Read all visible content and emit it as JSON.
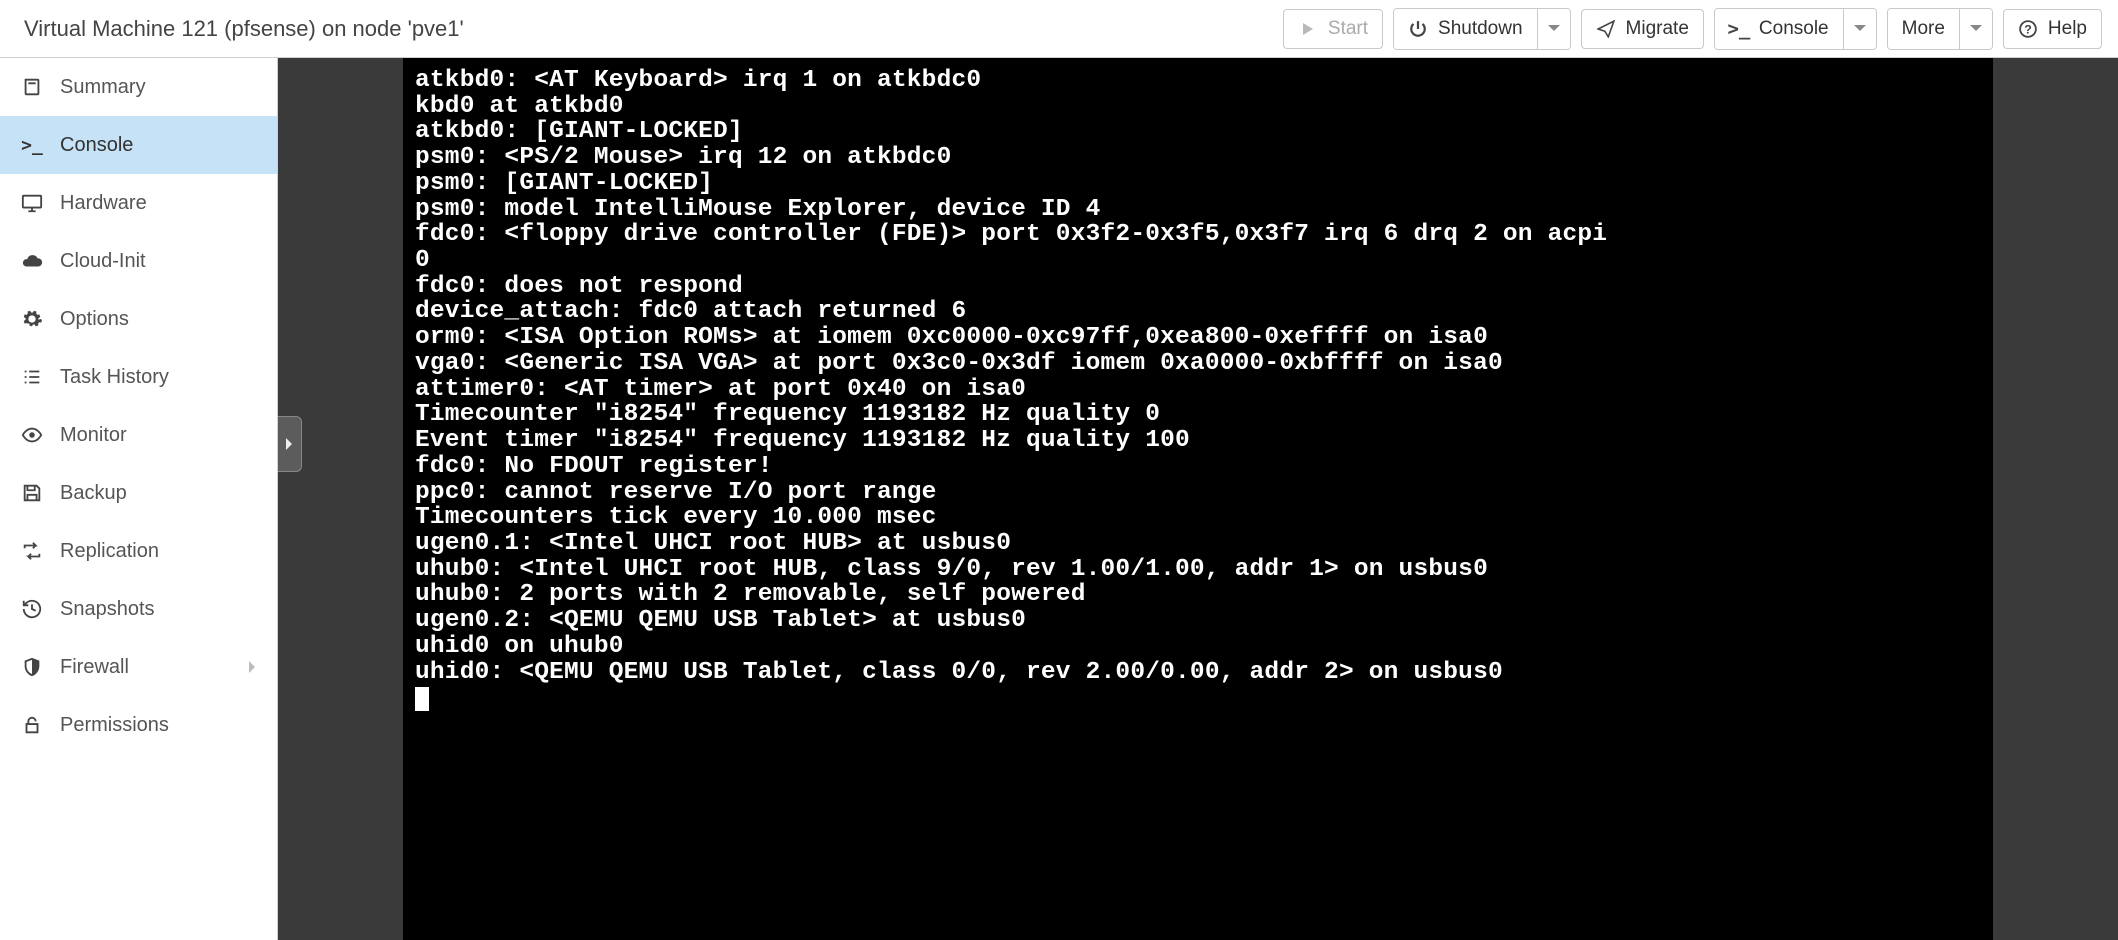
{
  "header": {
    "title": "Virtual Machine 121 (pfsense) on node 'pve1'",
    "buttons": {
      "start": "Start",
      "shutdown": "Shutdown",
      "migrate": "Migrate",
      "console": "Console",
      "more": "More",
      "help": "Help"
    }
  },
  "sidebar": {
    "items": [
      {
        "id": "summary",
        "label": "Summary",
        "icon": "book-icon"
      },
      {
        "id": "console",
        "label": "Console",
        "icon": "terminal-icon",
        "active": true
      },
      {
        "id": "hardware",
        "label": "Hardware",
        "icon": "monitor-icon"
      },
      {
        "id": "cloud-init",
        "label": "Cloud-Init",
        "icon": "cloud-icon"
      },
      {
        "id": "options",
        "label": "Options",
        "icon": "gear-icon"
      },
      {
        "id": "task-history",
        "label": "Task History",
        "icon": "list-icon"
      },
      {
        "id": "monitor",
        "label": "Monitor",
        "icon": "eye-icon"
      },
      {
        "id": "backup",
        "label": "Backup",
        "icon": "save-icon"
      },
      {
        "id": "replication",
        "label": "Replication",
        "icon": "retweet-icon"
      },
      {
        "id": "snapshots",
        "label": "Snapshots",
        "icon": "history-icon"
      },
      {
        "id": "firewall",
        "label": "Firewall",
        "icon": "shield-icon",
        "expandable": true
      },
      {
        "id": "permissions",
        "label": "Permissions",
        "icon": "unlock-icon"
      }
    ]
  },
  "terminal": {
    "lines": [
      "atkbd0: <AT Keyboard> irq 1 on atkbdc0",
      "kbd0 at atkbd0",
      "atkbd0: [GIANT-LOCKED]",
      "psm0: <PS/2 Mouse> irq 12 on atkbdc0",
      "psm0: [GIANT-LOCKED]",
      "psm0: model IntelliMouse Explorer, device ID 4",
      "fdc0: <floppy drive controller (FDE)> port 0x3f2-0x3f5,0x3f7 irq 6 drq 2 on acpi",
      "0",
      "fdc0: does not respond",
      "device_attach: fdc0 attach returned 6",
      "orm0: <ISA Option ROMs> at iomem 0xc0000-0xc97ff,0xea800-0xeffff on isa0",
      "vga0: <Generic ISA VGA> at port 0x3c0-0x3df iomem 0xa0000-0xbffff on isa0",
      "attimer0: <AT timer> at port 0x40 on isa0",
      "Timecounter \"i8254\" frequency 1193182 Hz quality 0",
      "Event timer \"i8254\" frequency 1193182 Hz quality 100",
      "fdc0: No FDOUT register!",
      "ppc0: cannot reserve I/O port range",
      "Timecounters tick every 10.000 msec",
      "ugen0.1: <Intel UHCI root HUB> at usbus0",
      "uhub0: <Intel UHCI root HUB, class 9/0, rev 1.00/1.00, addr 1> on usbus0",
      "uhub0: 2 ports with 2 removable, self powered",
      "ugen0.2: <QEMU QEMU USB Tablet> at usbus0",
      "uhid0 on uhub0",
      "uhid0: <QEMU QEMU USB Tablet, class 0/0, rev 2.00/0.00, addr 2> on usbus0"
    ]
  }
}
